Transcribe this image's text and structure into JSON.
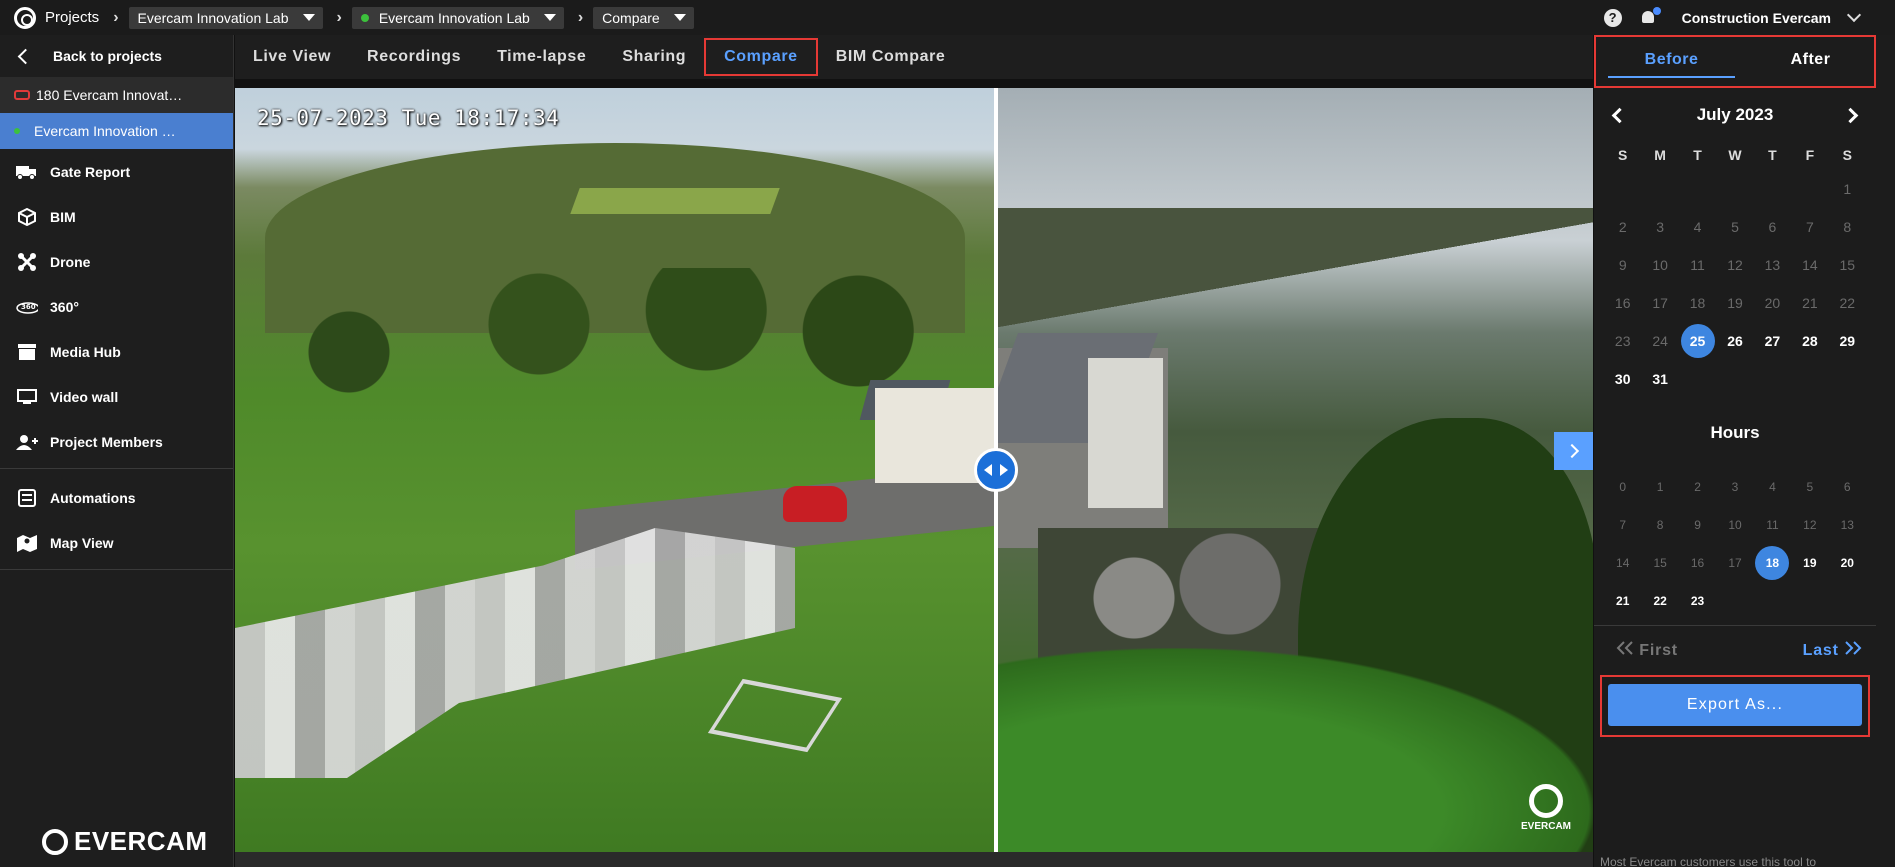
{
  "topbar": {
    "projects_label": "Projects",
    "breadcrumbs": [
      {
        "label": "Evercam Innovation Lab",
        "dot": false
      },
      {
        "label": "Evercam Innovation Lab",
        "dot": true
      },
      {
        "label": "Compare",
        "dot": false
      }
    ],
    "user_name": "Construction Evercam",
    "help_glyph": "?"
  },
  "sidebar": {
    "back_label": "Back to projects",
    "projects": [
      {
        "label": "180 Evercam Innovat…",
        "status": "offline"
      },
      {
        "label": "Evercam Innovation …",
        "status": "online"
      }
    ],
    "items": [
      {
        "label": "Gate Report",
        "icon": "truck-icon"
      },
      {
        "label": "BIM",
        "icon": "cube-icon"
      },
      {
        "label": "Drone",
        "icon": "drone-icon"
      },
      {
        "label": "360°",
        "icon": "360-icon"
      },
      {
        "label": "Media Hub",
        "icon": "media-icon"
      },
      {
        "label": "Video wall",
        "icon": "monitor-icon"
      },
      {
        "label": "Project Members",
        "icon": "add-user-icon"
      }
    ],
    "items2": [
      {
        "label": "Automations",
        "icon": "automation-icon"
      },
      {
        "label": "Map View",
        "icon": "map-icon"
      }
    ],
    "footer_logo": "EVERCAM"
  },
  "tabs": [
    "Live View",
    "Recordings",
    "Time-lapse",
    "Sharing",
    "Compare",
    "BIM Compare"
  ],
  "active_tab": "Compare",
  "viewer": {
    "timestamp": "25-07-2023 Tue 18:17:34",
    "watermark": "EVERCAM"
  },
  "panel": {
    "before_label": "Before",
    "after_label": "After",
    "month_label": "July 2023",
    "weekdays": [
      "S",
      "M",
      "T",
      "W",
      "T",
      "F",
      "S"
    ],
    "days": [
      "",
      "",
      "",
      "",
      "",
      "",
      "1",
      "2",
      "3",
      "4",
      "5",
      "6",
      "7",
      "8",
      "9",
      "10",
      "11",
      "12",
      "13",
      "14",
      "15",
      "16",
      "17",
      "18",
      "19",
      "20",
      "21",
      "22",
      "23",
      "24",
      "25",
      "26",
      "27",
      "28",
      "29",
      "30",
      "31",
      "",
      "",
      "",
      "",
      ""
    ],
    "available_days": [
      "25",
      "26",
      "27",
      "28",
      "29",
      "30",
      "31"
    ],
    "selected_day": "25",
    "hours_title": "Hours",
    "hours": [
      "0",
      "1",
      "2",
      "3",
      "4",
      "5",
      "6",
      "7",
      "8",
      "9",
      "10",
      "11",
      "12",
      "13",
      "14",
      "15",
      "16",
      "17",
      "18",
      "19",
      "20",
      "21",
      "22",
      "23"
    ],
    "available_hours": [
      "18",
      "19",
      "20",
      "21",
      "22",
      "23"
    ],
    "selected_hour": "18",
    "first_label": "First",
    "last_label": "Last",
    "export_label": "Export As...",
    "footer_text": "Most Evercam customers use this tool to"
  },
  "colors": {
    "accent": "#5aa0ff",
    "highlight_border": "#e53935",
    "sidebar_active": "#4a7fd0"
  }
}
